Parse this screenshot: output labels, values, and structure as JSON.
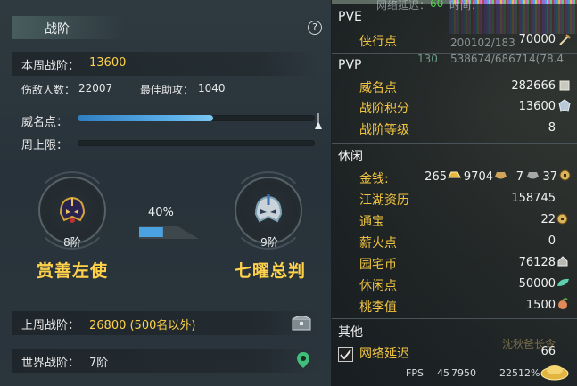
{
  "left_panel": {
    "title": "战阶",
    "help_label": "?",
    "weekly_rank_label": "本周战阶：",
    "weekly_rank_value": "13600",
    "defeated_label": "伤敌人数：",
    "defeated_value": "22007",
    "best_assist_label": "最佳助攻：",
    "best_assist_value": "1040",
    "reputation_label": "威名点：",
    "reputation_progress": 0.57,
    "weekly_cap_label": "周上限：",
    "weekly_cap_progress": 0,
    "current_rank": {
      "level": "8阶",
      "name": "赏善左使"
    },
    "next_rank": {
      "level": "9阶",
      "name": "七曜总判"
    },
    "rank_progress_text": "40%",
    "rank_progress": 0.4,
    "last_week_label": "上周战阶：",
    "last_week_value": "26800 (500名以外)",
    "world_rank_label": "世界战阶：",
    "world_rank_value": "7阶"
  },
  "right_panel": {
    "overlay": {
      "top_text": "网络延迟：",
      "top_number": "60",
      "top_time": "时间：",
      "hp_text": "200102/183",
      "mp_text": "538674/686714(78.4",
      "level": "130",
      "bottom_overlay": "沈秋爸长令"
    },
    "pve": {
      "title": "PVE",
      "items": [
        {
          "label": "侠行点",
          "value": "70000",
          "icon": "sword-icon"
        }
      ]
    },
    "pvp": {
      "title": "PVP",
      "items": [
        {
          "label": "威名点",
          "value": "282666",
          "icon": "emblem-icon"
        },
        {
          "label": "战阶积分",
          "value": "13600",
          "icon": "badge-icon"
        },
        {
          "label": "战阶等级",
          "value": "8",
          "icon": ""
        }
      ]
    },
    "leisure": {
      "title": "休闲",
      "money_label": "金钱:",
      "money_gold": "265",
      "money_silver": "9704",
      "money_copper": "7",
      "money_coin": "37",
      "items": [
        {
          "label": "江湖资历",
          "value": "158745",
          "icon": ""
        },
        {
          "label": "通宝",
          "value": "22",
          "icon": "coin-icon"
        },
        {
          "label": "薪火点",
          "value": "0",
          "icon": ""
        },
        {
          "label": "园宅币",
          "value": "76128",
          "icon": "house-coin-icon"
        },
        {
          "label": "休闲点",
          "value": "50000",
          "icon": "leaf-icon"
        },
        {
          "label": "桃李值",
          "value": "1500",
          "icon": "peach-icon"
        }
      ]
    },
    "other": {
      "title": "其他",
      "network_label": "网络延迟",
      "network_value": "66"
    },
    "footer": {
      "fps_label": "FPS",
      "fps_value": "45",
      "footer_num": "7950",
      "ping": "22512%"
    }
  },
  "colors": {
    "accent_yellow": "#ffd24a",
    "label_gold": "#f2c542",
    "bar_blue": "#4aa3e0",
    "green": "#54d04e"
  }
}
